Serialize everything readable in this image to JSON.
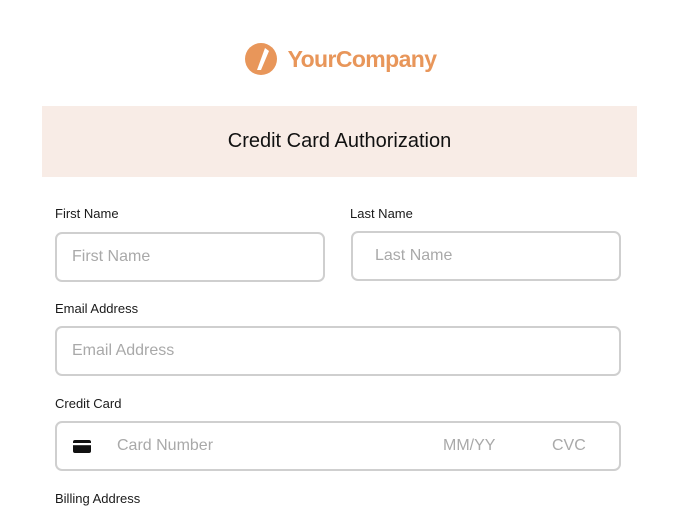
{
  "brand": {
    "name": "YourCompany",
    "color": "#e8965a"
  },
  "form": {
    "title": "Credit Card Authorization",
    "first_name": {
      "label": "First Name",
      "placeholder": "First Name",
      "value": ""
    },
    "last_name": {
      "label": "Last Name",
      "placeholder": "Last Name",
      "value": ""
    },
    "email": {
      "label": "Email Address",
      "placeholder": "Email Address",
      "value": ""
    },
    "credit_card": {
      "label": "Credit Card",
      "icon": "credit-card-icon",
      "number_placeholder": "Card Number",
      "expiry_placeholder": "MM/YY",
      "cvc_placeholder": "CVC"
    },
    "billing_address": {
      "label": "Billing Address"
    }
  },
  "colors": {
    "header_background": "#f8ece6",
    "input_border": "#cfcfcf",
    "placeholder_text": "#a9a9a9"
  }
}
